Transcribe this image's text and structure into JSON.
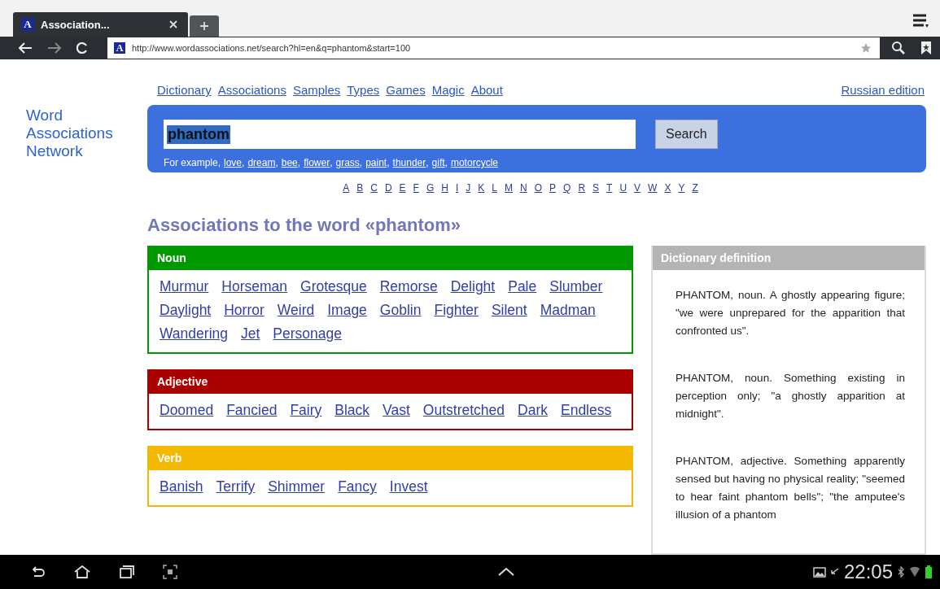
{
  "browser": {
    "tab": {
      "title": "Association...",
      "favicon": "A"
    },
    "address": {
      "favicon": "A",
      "url": "http://www.wordassociations.net/search?hl=en&q=phantom&start=100"
    }
  },
  "site": {
    "logo": [
      "Word",
      "Associations",
      "Network"
    ],
    "nav": [
      "Dictionary",
      "Associations",
      "Samples",
      "Types",
      "Games",
      "Magic",
      "About"
    ],
    "edition_link": "Russian edition",
    "search": {
      "value": "phantom",
      "button": "Search",
      "example_label": "For example,",
      "examples": [
        {
          "word": "love",
          "sep": ","
        },
        {
          "word": "dream",
          "sep": ","
        },
        {
          "word": "bee",
          "sep": ","
        },
        {
          "word": "flower",
          "sep": ","
        },
        {
          "word": "grass",
          "sep": ","
        },
        {
          "word": "paint",
          "sep": ","
        },
        {
          "word": "thunder",
          "sep": ","
        },
        {
          "word": "gift",
          "sep": ","
        },
        {
          "word": "motorcycle"
        }
      ]
    },
    "alphabet": [
      "A",
      "B",
      "C",
      "D",
      "E",
      "F",
      "G",
      "H",
      "I",
      "J",
      "K",
      "L",
      "M",
      "N",
      "O",
      "P",
      "Q",
      "R",
      "S",
      "T",
      "U",
      "V",
      "W",
      "X",
      "Y",
      "Z"
    ],
    "heading": "Associations to the word «phantom»",
    "sections": [
      {
        "title": "Noun",
        "color": "#009900",
        "words": [
          "Murmur",
          "Horseman",
          "Grotesque",
          "Remorse",
          "Delight",
          "Pale",
          "Slumber",
          "Daylight",
          "Horror",
          "Weird",
          "Image",
          "Goblin",
          "Fighter",
          "Silent",
          "Madman",
          "Wandering",
          "Jet",
          "Personage"
        ]
      },
      {
        "title": "Adjective",
        "color": "#aa0000",
        "words": [
          "Doomed",
          "Fancied",
          "Fairy",
          "Black",
          "Vast",
          "Outstretched",
          "Dark",
          "Endless"
        ]
      },
      {
        "title": "Verb",
        "color": "#f5b800",
        "words": [
          "Banish",
          "Terrify",
          "Shimmer",
          "Fancy",
          "Invest"
        ]
      }
    ],
    "definition": {
      "title": "Dictionary definition",
      "entries": [
        "PHANTOM, noun. A ghostly appearing figure; \"we were unprepared for the apparition that confronted us\".",
        "PHANTOM, noun. Something existing in perception only; \"a ghostly apparition at midnight\".",
        "PHANTOM, adjective. Something apparently sensed but having no physical reality; \"seemed to hear faint phantom bells\"; \"the amputee's illusion of a phantom"
      ]
    }
  },
  "status_bar": {
    "time": "22:05"
  }
}
